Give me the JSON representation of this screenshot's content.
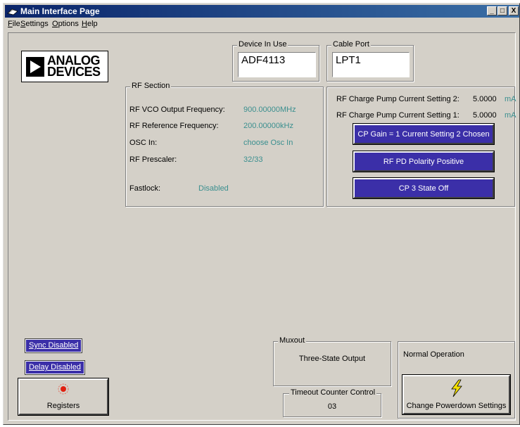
{
  "window": {
    "title": "Main Interface Page",
    "min_glyph": "_",
    "max_glyph": "□",
    "close_glyph": "X"
  },
  "menu": {
    "items": [
      "File",
      "Settings",
      "Options",
      "Help"
    ]
  },
  "logo": {
    "line1": "ANALOG",
    "line2": "DEVICES"
  },
  "device": {
    "label": "Device In Use",
    "value": "ADF4113"
  },
  "cable": {
    "label": "Cable Port",
    "value": "LPT1"
  },
  "rf_section": {
    "label": "RF Section",
    "rows": [
      {
        "label": "RF VCO Output Frequency:",
        "value": "900.00000MHz"
      },
      {
        "label": "RF Reference Frequency:",
        "value": "200.00000kHz"
      },
      {
        "label": "OSC In:",
        "value": "choose Osc In"
      },
      {
        "label": "RF Prescaler:",
        "value": "32/33"
      }
    ],
    "fastlock_label": "Fastlock:",
    "fastlock_value": "Disabled"
  },
  "charge_pump": {
    "setting2_label": "RF Charge Pump Current Setting 2:",
    "setting2_value": "5.0000",
    "setting2_unit": "mA",
    "setting1_label": "RF Charge Pump Current Setting 1:",
    "setting1_value": "5.0000",
    "setting1_unit": "mA",
    "cp_gain_button": "CP Gain = 1 Current Setting 2 Chosen",
    "pd_polarity_button": "RF PD Polarity Positive",
    "cp_state_button": "CP 3 State Off"
  },
  "bottom": {
    "sync_button": "Sync Disabled",
    "delay_button": "Delay Disabled",
    "registers_button": "Registers",
    "muxout_label": "Muxout",
    "muxout_value": "Three-State Output",
    "timeout_label": "Timeout Counter Control",
    "timeout_value": "03",
    "power_status": "Normal Operation",
    "powerdown_button": "Change Powerdown Settings"
  },
  "colors": {
    "button_purple": "#3b2fa8",
    "value_teal": "#3a8f8f",
    "title_bar": "#0a246a",
    "led_red": "#e02010",
    "bolt_yellow": "#f5e000"
  },
  "icons": {
    "app": "app-icon",
    "registers": "led-icon",
    "powerdown": "lightning-icon"
  }
}
